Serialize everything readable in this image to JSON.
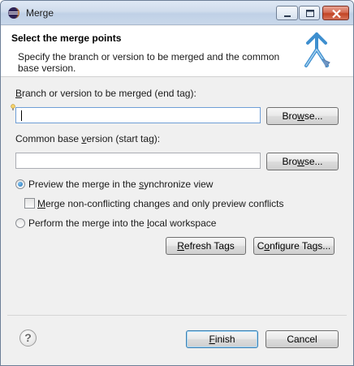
{
  "window": {
    "title": "Merge",
    "icon": "eclipse-icon"
  },
  "header": {
    "title": "Select the merge points",
    "description": "Specify the branch or version to be merged and the common base version.",
    "logo": "merge-arrows-icon"
  },
  "end_tag": {
    "label_mnemonic": "B",
    "label_rest": "ranch or version to be merged (end tag):",
    "value": "",
    "browse_pre": "Bro",
    "browse_mnemonic": "w",
    "browse_post": "se..."
  },
  "base_tag": {
    "label_pre": "Common base ",
    "label_mnemonic": "v",
    "label_post": "ersion (start tag):",
    "value": "",
    "browse_pre": "Bro",
    "browse_mnemonic": "w",
    "browse_post": "se..."
  },
  "options": {
    "preview": {
      "pre": "Preview the merge in the ",
      "mnemonic": "s",
      "post": "ynchronize view",
      "checked": true
    },
    "non_conflicting": {
      "mnemonic": "M",
      "post": "erge non-conflicting changes and only preview conflicts",
      "checked": false
    },
    "perform": {
      "pre": "Perform the merge into the ",
      "mnemonic": "l",
      "post": "ocal workspace",
      "checked": false
    }
  },
  "tag_buttons": {
    "refresh_mnemonic": "R",
    "refresh_post": "efresh Tags",
    "configure_pre": "C",
    "configure_mnemonic": "o",
    "configure_post": "nfigure Tags..."
  },
  "footer": {
    "help": "?",
    "finish_mnemonic": "F",
    "finish_post": "inish",
    "cancel": "Cancel"
  }
}
